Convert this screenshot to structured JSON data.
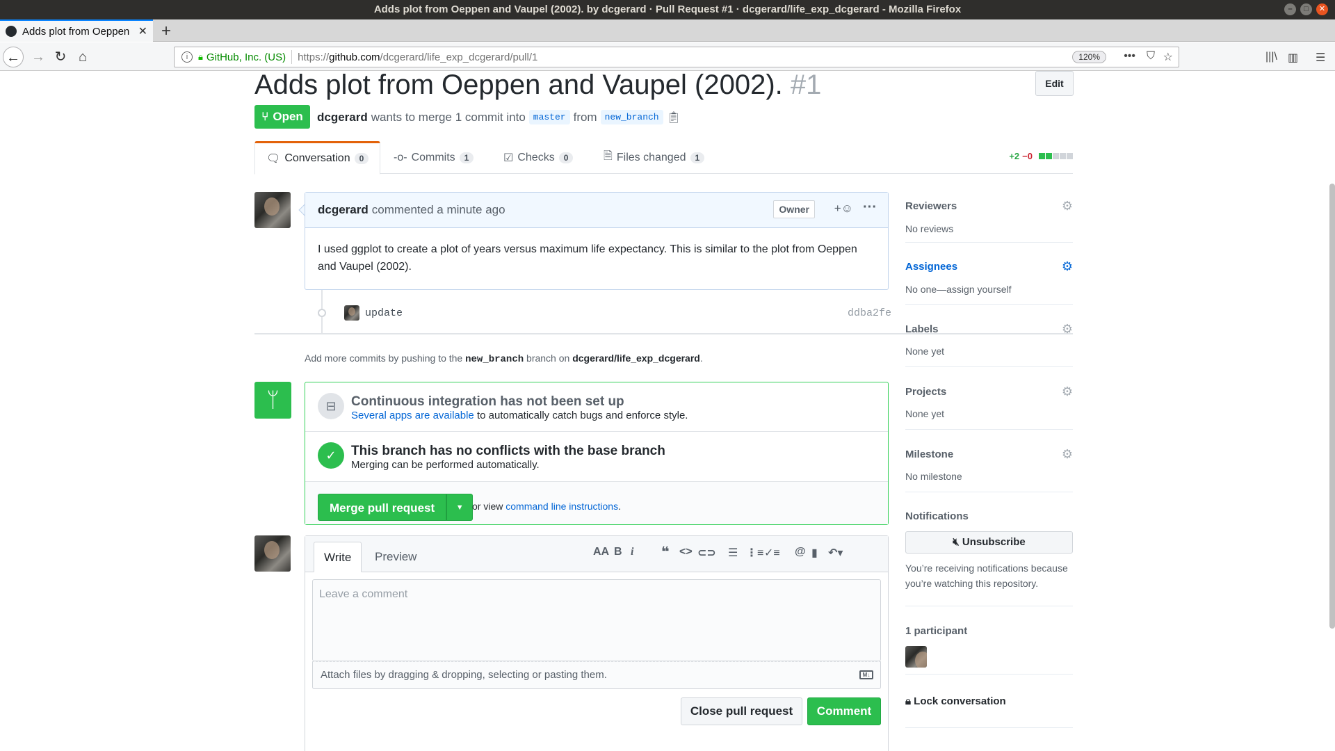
{
  "window": {
    "title": "Adds plot from Oeppen and Vaupel (2002). by dcgerard · Pull Request #1 · dcgerard/life_exp_dcgerard - Mozilla Firefox"
  },
  "browser": {
    "tab_title": "Adds plot from Oeppen",
    "identity": "GitHub, Inc. (US)",
    "url_prefix": "https://",
    "url_host": "github.com",
    "url_path": "/dcgerard/life_exp_dcgerard/pull/1",
    "zoom": "120%"
  },
  "pr": {
    "title": "Adds plot from Oeppen and Vaupel (2002).",
    "number": "#1",
    "edit_label": "Edit",
    "state": "Open",
    "author": "dcgerard",
    "meta_text": "wants to merge 1 commit into",
    "base_branch": "master",
    "from_text": "from",
    "head_branch": "new_branch"
  },
  "tabs": [
    {
      "label": "Conversation",
      "count": "0"
    },
    {
      "label": "Commits",
      "count": "1"
    },
    {
      "label": "Checks",
      "count": "0"
    },
    {
      "label": "Files changed",
      "count": "1"
    }
  ],
  "diffstat": {
    "additions": "+2",
    "deletions": "−0",
    "green": "#2cbe4e",
    "gray": "#d1d5da"
  },
  "comment": {
    "author": "dcgerard",
    "action": "commented a minute ago",
    "badge": "Owner",
    "body": "I used ggplot to create a plot of years versus maximum life expectancy. This is similar to the plot from Oeppen and Vaupel (2002)."
  },
  "commit": {
    "message": "update",
    "sha": "ddba2fe"
  },
  "push_hint": {
    "before": "Add more commits by pushing to the",
    "branch": "new_branch",
    "middle": "branch on",
    "repo": "dcgerard/life_exp_dcgerard",
    "after": "."
  },
  "merge": {
    "ci_title": "Continuous integration has not been set up",
    "ci_link": "Several apps are available",
    "ci_rest": "to automatically catch bugs and enforce style.",
    "ok_title": "This branch has no conflicts with the base branch",
    "ok_sub": "Merging can be performed automatically.",
    "button": "Merge pull request",
    "or_view": "or view",
    "cli_link": "command line instructions",
    "period": "."
  },
  "new_comment": {
    "write_tab": "Write",
    "preview_tab": "Preview",
    "placeholder": "Leave a comment",
    "attach": "Attach files by dragging & dropping, selecting or pasting them.",
    "close_button": "Close pull request",
    "comment_button": "Comment"
  },
  "sidebar": {
    "reviewers": {
      "heading": "Reviewers",
      "value": "No reviews"
    },
    "assignees": {
      "heading": "Assignees",
      "value": "No one—assign yourself"
    },
    "labels": {
      "heading": "Labels",
      "value": "None yet"
    },
    "projects": {
      "heading": "Projects",
      "value": "None yet"
    },
    "milestone": {
      "heading": "Milestone",
      "value": "No milestone"
    },
    "notifications": {
      "heading": "Notifications",
      "button": "Unsubscribe",
      "note": "You’re receiving notifications because you’re watching this repository."
    },
    "participants": {
      "heading": "1 participant"
    },
    "lock": "Lock conversation"
  }
}
